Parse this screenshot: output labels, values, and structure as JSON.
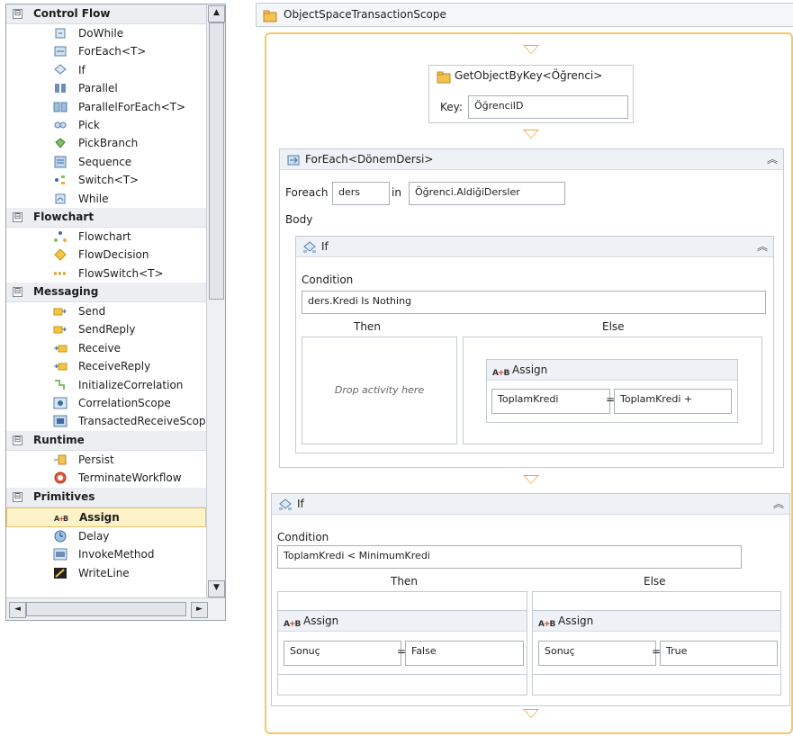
{
  "toolbox": {
    "categories": [
      {
        "label": "Control Flow",
        "expander": "⊟",
        "items": [
          {
            "label": "DoWhile",
            "icon": "dowhile-icon"
          },
          {
            "label": "ForEach<T>",
            "icon": "foreach-icon"
          },
          {
            "label": "If",
            "icon": "if-icon"
          },
          {
            "label": "Parallel",
            "icon": "parallel-icon"
          },
          {
            "label": "ParallelForEach<T>",
            "icon": "parallelforeach-icon"
          },
          {
            "label": "Pick",
            "icon": "pick-icon"
          },
          {
            "label": "PickBranch",
            "icon": "pickbranch-icon"
          },
          {
            "label": "Sequence",
            "icon": "sequence-icon"
          },
          {
            "label": "Switch<T>",
            "icon": "switch-icon"
          },
          {
            "label": "While",
            "icon": "while-icon"
          }
        ]
      },
      {
        "label": "Flowchart",
        "expander": "⊟",
        "items": [
          {
            "label": "Flowchart",
            "icon": "flowchart-icon"
          },
          {
            "label": "FlowDecision",
            "icon": "flowdecision-icon"
          },
          {
            "label": "FlowSwitch<T>",
            "icon": "flowswitch-icon"
          }
        ]
      },
      {
        "label": "Messaging",
        "expander": "⊟",
        "items": [
          {
            "label": "Send",
            "icon": "send-icon"
          },
          {
            "label": "SendReply",
            "icon": "sendreply-icon"
          },
          {
            "label": "Receive",
            "icon": "receive-icon"
          },
          {
            "label": "ReceiveReply",
            "icon": "receivereply-icon"
          },
          {
            "label": "InitializeCorrelation",
            "icon": "initializecorrelation-icon"
          },
          {
            "label": "CorrelationScope",
            "icon": "correlationscope-icon"
          },
          {
            "label": "TransactedReceiveScope",
            "icon": "transactedreceivescope-icon"
          }
        ]
      },
      {
        "label": "Runtime",
        "expander": "⊟",
        "items": [
          {
            "label": "Persist",
            "icon": "persist-icon"
          },
          {
            "label": "TerminateWorkflow",
            "icon": "terminateworkflow-icon"
          }
        ]
      },
      {
        "label": "Primitives",
        "expander": "⊟",
        "items": [
          {
            "label": "Assign",
            "icon": "assign-icon",
            "selected": true
          },
          {
            "label": "Delay",
            "icon": "delay-icon"
          },
          {
            "label": "InvokeMethod",
            "icon": "invokemethod-icon"
          },
          {
            "label": "WriteLine",
            "icon": "writeline-icon"
          }
        ]
      }
    ],
    "scroll_up": "▲",
    "scroll_down": "▼",
    "scroll_left": "◄",
    "scroll_right": "►"
  },
  "designer": {
    "scope_title": "ObjectSpaceTransactionScope",
    "get_object": {
      "title": "GetObjectByKey<Öğrenci>",
      "key_label": "Key:",
      "key_value": "ÖğrenciID"
    },
    "foreach": {
      "title": "ForEach<DönemDersi>",
      "foreach_label": "Foreach",
      "item_value": "ders",
      "in_label": "in",
      "collection_value": "Öğrenci.AldiğiDersler",
      "body_label": "Body",
      "collapse": "︽",
      "inner_if": {
        "title": "If",
        "collapse": "︽",
        "condition_label": "Condition",
        "condition_value": "ders.Kredi Is Nothing",
        "then_label": "Then",
        "else_label": "Else",
        "drop_text": "Drop activity here",
        "assign": {
          "title": "Assign",
          "to": "ToplamKredi",
          "eq": "=",
          "value": "ToplamKredi +"
        }
      }
    },
    "outer_if": {
      "title": "If",
      "collapse": "︽",
      "condition_label": "Condition",
      "condition_value": "ToplamKredi < MinimumKredi",
      "then_label": "Then",
      "else_label": "Else",
      "then_assign": {
        "title": "Assign",
        "to": "Sonuç",
        "eq": "=",
        "value": "False"
      },
      "else_assign": {
        "title": "Assign",
        "to": "Sonuç",
        "eq": "=",
        "value": "True"
      }
    },
    "assign_icon": {
      "a": "A",
      "arrow": "+",
      "b": "B"
    },
    "colors": {
      "accent": "#f5c66a",
      "connector": "#f2a83b",
      "selection": "#fdf2c8"
    }
  }
}
